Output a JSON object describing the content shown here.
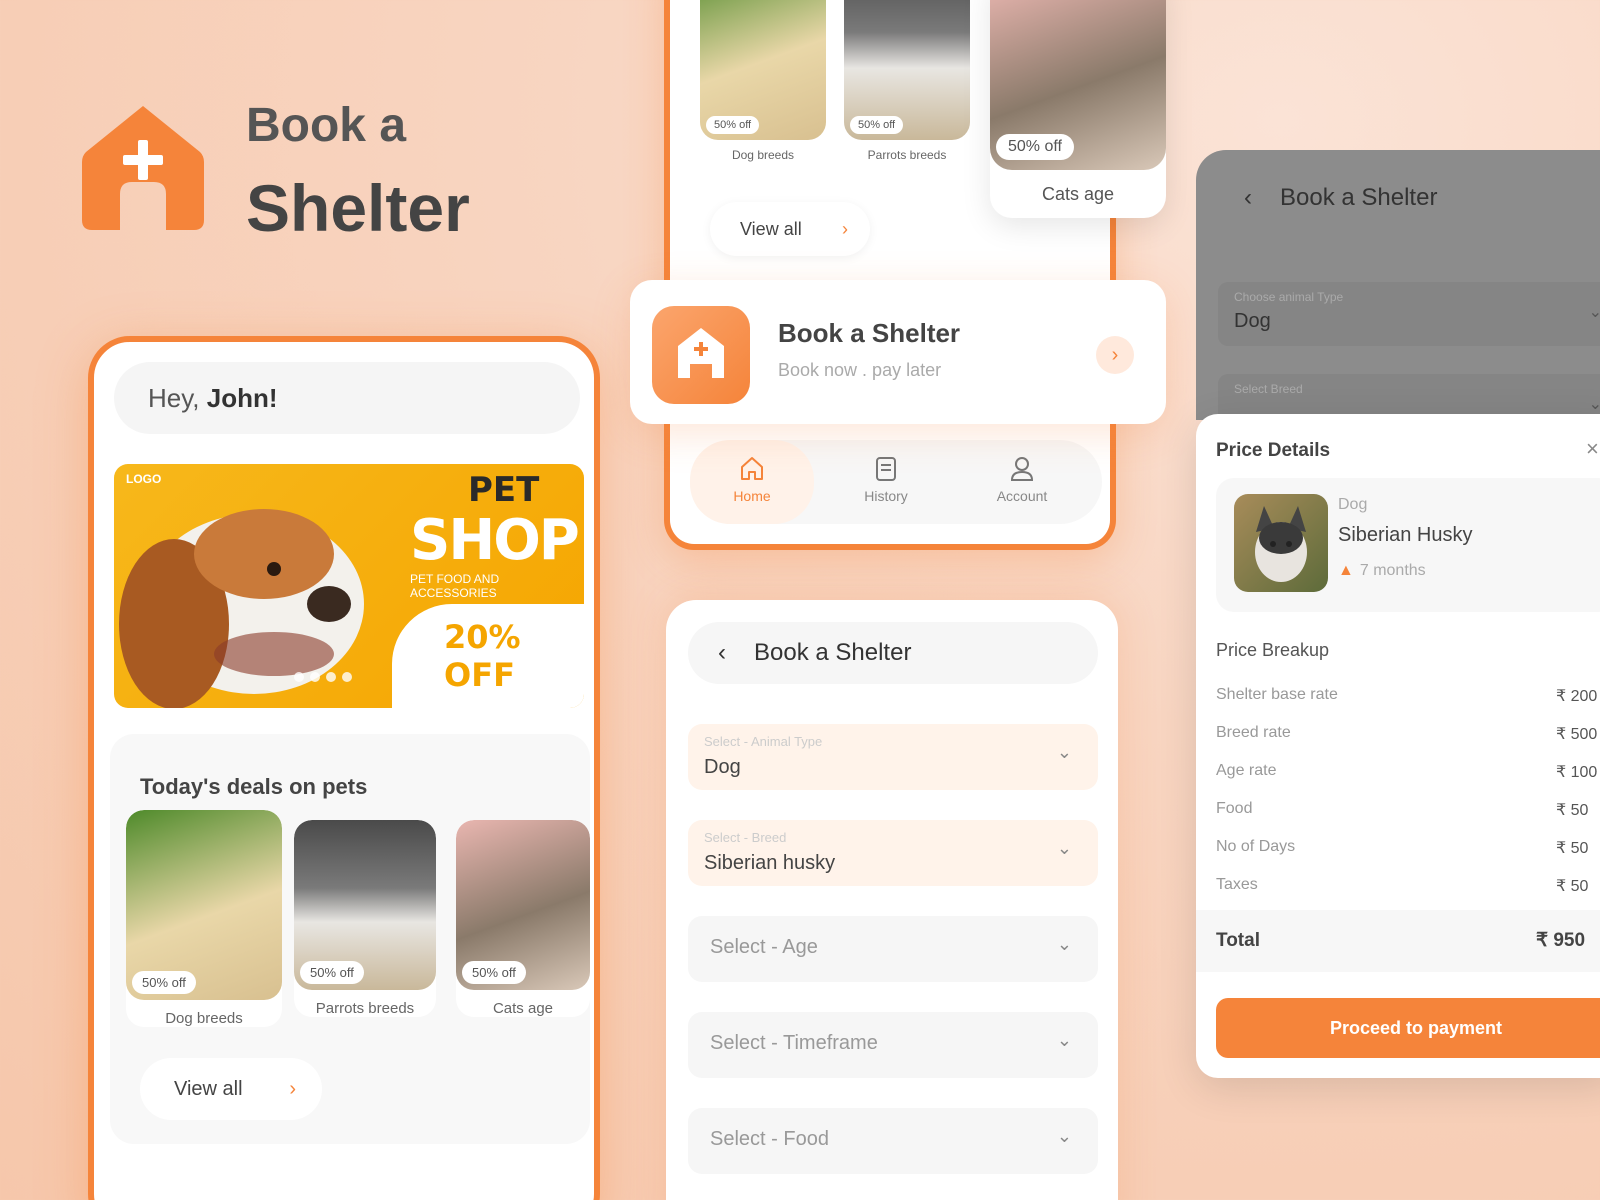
{
  "brand": {
    "title_line1": "Book a",
    "title_line2": "Shelter",
    "accent_color": "#f5843a"
  },
  "home_screen": {
    "greeting_prefix": "Hey, ",
    "greeting_name": "John!",
    "banner": {
      "logo": "LOGO",
      "pet": "PET",
      "shop": "SHOP",
      "subtitle": "PET FOOD AND ACCESSORIES",
      "discount": "20% OFF"
    },
    "deals_title": "Today's deals on pets",
    "deals": [
      {
        "label": "Dog breeds",
        "badge": "50% off"
      },
      {
        "label": "Parrots breeds",
        "badge": "50% off"
      },
      {
        "label": "Cats age",
        "badge": "50% off"
      }
    ],
    "view_all": "View all"
  },
  "home_screen_2": {
    "deals": [
      {
        "label": "Dog breeds",
        "badge": "50% off"
      },
      {
        "label": "Parrots breeds",
        "badge": "50% off"
      },
      {
        "label": "Cats age",
        "badge": "50% off"
      }
    ],
    "view_all": "View all",
    "shelter_card": {
      "title": "Book a Shelter",
      "subtitle": "Book now . pay later"
    },
    "tabs": [
      {
        "label": "Home",
        "icon": "home-icon"
      },
      {
        "label": "History",
        "icon": "history-icon"
      },
      {
        "label": "Account",
        "icon": "account-icon"
      }
    ]
  },
  "form_screen": {
    "title": "Book a Shelter",
    "fields": [
      {
        "small_label": "Select - Animal Type",
        "value": "Dog"
      },
      {
        "small_label": "Select - Breed",
        "value": "Siberian husky"
      },
      {
        "placeholder": "Select - Age"
      },
      {
        "placeholder": "Select - Timeframe"
      },
      {
        "placeholder": "Select - Food"
      }
    ]
  },
  "price_screen": {
    "title": "Book a Shelter",
    "fields": [
      {
        "small_label": "Choose animal Type",
        "value": "Dog"
      },
      {
        "small_label": "Select Breed",
        "value": "Siberian husky"
      }
    ],
    "sheet_title": "Price Details",
    "pet": {
      "type": "Dog",
      "name": "Siberian Husky",
      "age": "7 months"
    },
    "breakup_title": "Price Breakup",
    "breakup": [
      {
        "label": "Shelter base rate",
        "amount": "₹ 200"
      },
      {
        "label": "Breed rate",
        "amount": "₹ 500"
      },
      {
        "label": "Age rate",
        "amount": "₹ 100"
      },
      {
        "label": "Food",
        "amount": "₹ 50"
      },
      {
        "label": "No of Days",
        "amount": "₹ 50"
      },
      {
        "label": "Taxes",
        "amount": "₹ 50"
      }
    ],
    "total_label": "Total",
    "total_amount": "₹ 950",
    "pay_button": "Proceed to payment"
  }
}
